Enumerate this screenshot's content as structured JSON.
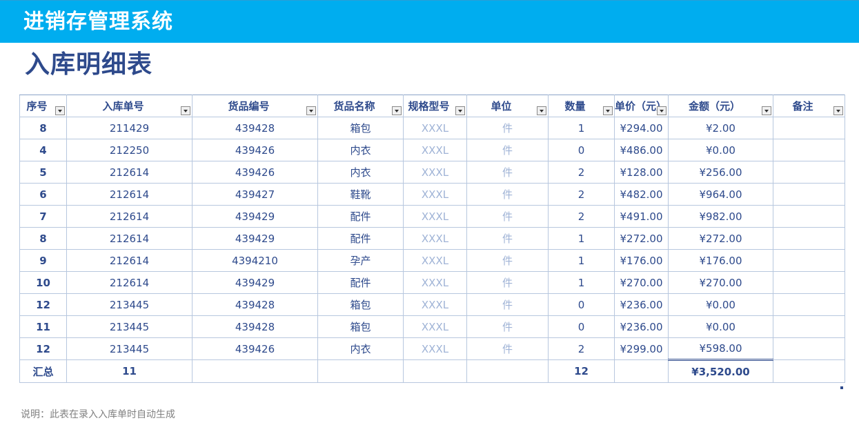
{
  "app": {
    "title": "进销存管理系统"
  },
  "page": {
    "title": "入库明细表",
    "note": "说明：此表在录入入库单时自动生成"
  },
  "table": {
    "headers": [
      "序号",
      "入库单号",
      "货品编号",
      "货品名称",
      "规格型号",
      "单位",
      "数量",
      "单价（元）",
      "金额（元）",
      "备注"
    ],
    "rows": [
      [
        "8",
        "211429",
        "439428",
        "箱包",
        "XXXL",
        "件",
        "1",
        "¥294.00",
        "¥2.00",
        ""
      ],
      [
        "4",
        "212250",
        "439426",
        "内衣",
        "XXXL",
        "件",
        "0",
        "¥486.00",
        "¥0.00",
        ""
      ],
      [
        "5",
        "212614",
        "439426",
        "内衣",
        "XXXL",
        "件",
        "2",
        "¥128.00",
        "¥256.00",
        ""
      ],
      [
        "6",
        "212614",
        "439427",
        "鞋靴",
        "XXXL",
        "件",
        "2",
        "¥482.00",
        "¥964.00",
        ""
      ],
      [
        "7",
        "212614",
        "439429",
        "配件",
        "XXXL",
        "件",
        "2",
        "¥491.00",
        "¥982.00",
        ""
      ],
      [
        "8",
        "212614",
        "439429",
        "配件",
        "XXXL",
        "件",
        "1",
        "¥272.00",
        "¥272.00",
        ""
      ],
      [
        "9",
        "212614",
        "4394210",
        "孕产",
        "XXXL",
        "件",
        "1",
        "¥176.00",
        "¥176.00",
        ""
      ],
      [
        "10",
        "212614",
        "439429",
        "配件",
        "XXXL",
        "件",
        "1",
        "¥270.00",
        "¥270.00",
        ""
      ],
      [
        "12",
        "213445",
        "439428",
        "箱包",
        "XXXL",
        "件",
        "0",
        "¥236.00",
        "¥0.00",
        ""
      ],
      [
        "11",
        "213445",
        "439428",
        "箱包",
        "XXXL",
        "件",
        "0",
        "¥236.00",
        "¥0.00",
        ""
      ],
      [
        "12",
        "213445",
        "439426",
        "内衣",
        "XXXL",
        "件",
        "2",
        "¥299.00",
        "¥598.00",
        ""
      ]
    ],
    "total": {
      "label": "汇总",
      "count": "11",
      "quantity": "12",
      "amount": "¥3,520.00"
    }
  },
  "colors": {
    "banner": "#00adef",
    "title": "#2e4a8c",
    "border": "#b7c7de",
    "muted": "#9fb3d6"
  },
  "icons": {
    "filter": "dropdown-filter-icon"
  }
}
